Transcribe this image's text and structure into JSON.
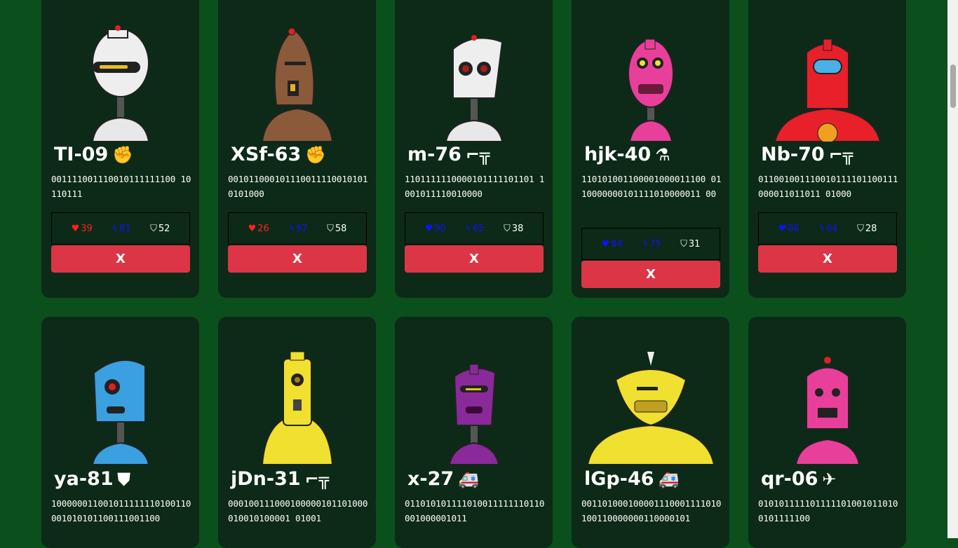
{
  "robots": [
    {
      "name": "TI-09",
      "type_icon": "fist-icon",
      "bits": "0011110011100101111111001011 0111",
      "stats": {
        "hp": "39",
        "atk": "81",
        "def": "52"
      },
      "hp_color": "#ff2020",
      "body_color": "#eeeeee",
      "remove_label": "X"
    },
    {
      "name": "XSf-63",
      "type_icon": "fist-icon",
      "bits": "00101100010111001111001010 10101000",
      "stats": {
        "hp": "26",
        "atk": "97",
        "def": "58"
      },
      "hp_color": "#ff2020",
      "body_color": "#8a5a3a",
      "remove_label": "X"
    },
    {
      "name": "m-76",
      "type_icon": "gun-icon",
      "bits": "1101111110000101111101101 1001011110010000",
      "stats": {
        "hp": "90",
        "atk": "65",
        "def": "38"
      },
      "hp_color": "#1010ff",
      "body_color": "#eeeeee",
      "remove_label": "X"
    },
    {
      "name": "hjk-40",
      "type_icon": "flask-icon",
      "bits": "1101010011000010000111000110000000101111010000011 00",
      "stats": {
        "hp": "84",
        "atk": "75",
        "def": "31"
      },
      "hp_color": "#1010ff",
      "body_color": "#e8409a",
      "remove_label": "X"
    },
    {
      "name": "Nb-70",
      "type_icon": "gun-icon",
      "bits": "01100100111001011110110 0111000011011011010000",
      "stats": {
        "hp": "86",
        "atk": "64",
        "def": "28"
      },
      "hp_color": "#1010ff",
      "body_color": "#e8202a",
      "remove_label": "X"
    },
    {
      "name": "ya-81",
      "type_icon": "shield-icon",
      "bits": "1000000110010111111101001100010101011001110011 00",
      "body_color": "#3aa0e0"
    },
    {
      "name": "jDn-31",
      "type_icon": "gun-icon",
      "bits": "0001001110001000001011010000100101000010 1001",
      "body_color": "#f0e030"
    },
    {
      "name": "x-27",
      "type_icon": "ambulance-icon",
      "bits": "0110101011110100111111101100010000 01011",
      "body_color": "#8a2a9a"
    },
    {
      "name": "lGp-46",
      "type_icon": "ambulance-icon",
      "bits": "00110100010000111000111101010011000000011000 0101",
      "body_color": "#f0e030"
    },
    {
      "name": "qr-06",
      "type_icon": "plane-icon",
      "bits": "0101011111011111010010110100101111100",
      "body_color": "#e8409a"
    }
  ],
  "display_bits": [
    "001111001110010111111100 10110111",
    "0010110001011100111100101010101000",
    "1101111110000101111101101 1001011110010000",
    "110101001100001000011100 0110000000101111010000011 00",
    "011001001110010111101100111000011011011 01000",
    "100000011001011111110100110001010101100111001100",
    "000100111000100000101101000010010100001 01001",
    "011010101111010011111110110001000001011",
    "001101000100001110001111010100110000000110000101",
    "0101011111011111010010110100101111100"
  ]
}
